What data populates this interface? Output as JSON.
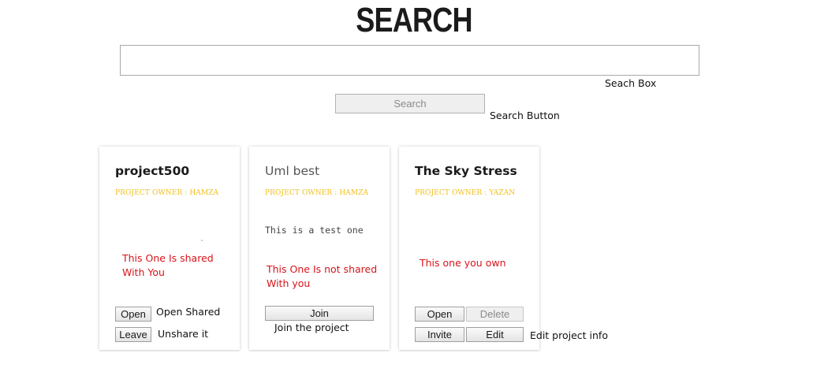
{
  "header": {
    "title": "SEARCH"
  },
  "search": {
    "value": "",
    "placeholder": "",
    "button_label": "Search",
    "box_note": "Seach Box",
    "button_note": "Search Button"
  },
  "projects": [
    {
      "name": "project500",
      "owner_label": "PROJECT OWNER : HAMZA",
      "description": "",
      "status_note": "This One Is shared With You",
      "buttons": {
        "open": "Open",
        "leave": "Leave"
      },
      "notes": {
        "open": "Open Shared",
        "leave": "Unshare it"
      }
    },
    {
      "name": "Uml best",
      "owner_label": "PROJECT OWNER : HAMZA",
      "description": "This is a test one",
      "status_note": "This One Is not shared With you",
      "buttons": {
        "join": "Join"
      },
      "notes": {
        "join": "Join the project"
      }
    },
    {
      "name": "The Sky Stress",
      "owner_label": "PROJECT OWNER : YAZAN",
      "description": "",
      "status_note": "This one you own",
      "buttons": {
        "open": "Open",
        "delete": "Delete",
        "invite": "Invite",
        "edit": "Edit"
      },
      "notes": {
        "edit": "Edit project info"
      }
    }
  ],
  "colors": {
    "owner": "#f0c020",
    "annotation_red": "#d8141a",
    "button_border": "#9f9f9f"
  }
}
